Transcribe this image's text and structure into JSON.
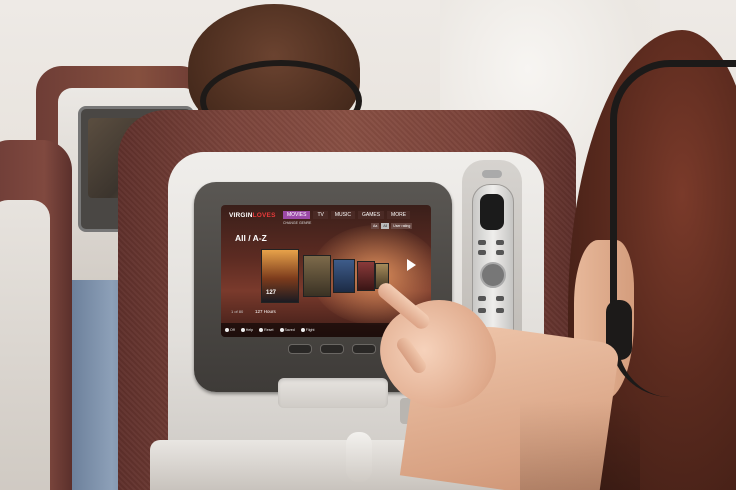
{
  "screen": {
    "brand_prefix": "VIRGIN",
    "brand_suffix": "LOVES",
    "tabs": [
      {
        "label": "MOVIES",
        "active": true
      },
      {
        "label": "TV",
        "active": false
      },
      {
        "label": "MUSIC",
        "active": false
      },
      {
        "label": "GAMES",
        "active": false
      },
      {
        "label": "MORE",
        "active": false
      }
    ],
    "change_genre": "CHANGE GENRE",
    "section_title": "All / A-Z",
    "mini_buttons": [
      "Aa",
      "All",
      "User rating"
    ],
    "featured_poster_text": "127",
    "duration": "127 Hours",
    "page_count": "1 of 80",
    "footer": [
      "Off",
      "Help",
      "Reset",
      "Saved",
      "Flight"
    ]
  },
  "colors": {
    "seat_fabric": "#7b443b",
    "shell": "#e2dfdb",
    "active_tab": "#9c4aa8",
    "brand_red": "#e83a3a"
  }
}
